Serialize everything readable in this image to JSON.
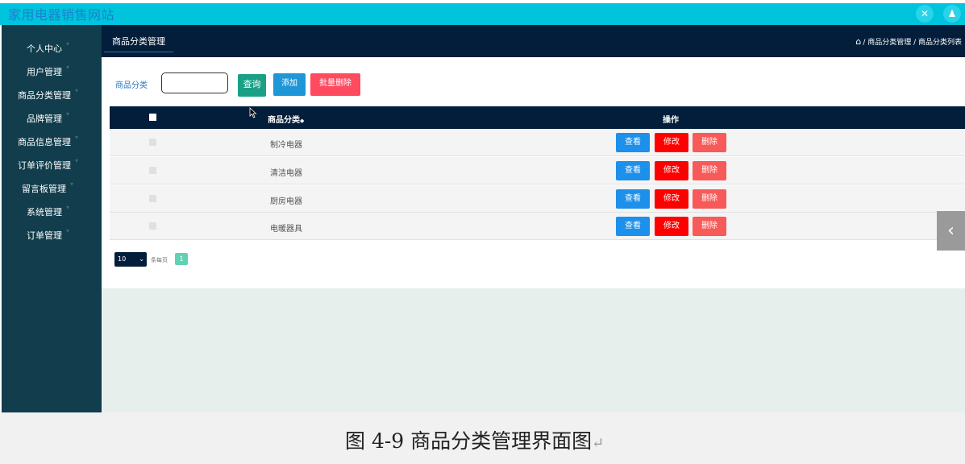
{
  "app": {
    "title": "家用电器销售网站"
  },
  "topbar": {
    "icon_close": "✕",
    "icon_user": "👤"
  },
  "sidebar": {
    "items": [
      {
        "label": "个人中心"
      },
      {
        "label": "用户管理"
      },
      {
        "label": "商品分类管理"
      },
      {
        "label": "品牌管理"
      },
      {
        "label": "商品信息管理"
      },
      {
        "label": "订单评价管理"
      },
      {
        "label": "留言板管理"
      },
      {
        "label": "系统管理"
      },
      {
        "label": "订单管理"
      }
    ]
  },
  "header": {
    "tab": "商品分类管理",
    "breadcrumb": "/ 商品分类管理 / 商品分类列表"
  },
  "search": {
    "label": "商品分类",
    "placeholder": "",
    "value": "",
    "query_label": "查询",
    "add_label": "添加",
    "batch_delete_label": "批量删除"
  },
  "table": {
    "columns": [
      "商品分类",
      "操作"
    ],
    "sort_glyph": "◆",
    "rows": [
      {
        "name": "制冷电器"
      },
      {
        "name": "清洁电器"
      },
      {
        "name": "厨房电器"
      },
      {
        "name": "电暖器具"
      }
    ],
    "actions": {
      "view": "查看",
      "edit": "修改",
      "delete": "删除"
    }
  },
  "pagination": {
    "page_size": "10",
    "per_page_text": "条每页",
    "current_page": "1"
  },
  "colors": {
    "topbar": "#00c3dc",
    "sidebar": "#113d4c",
    "header": "#021e3a",
    "view": "#1c90ea",
    "edit": "#ff0000",
    "delete": "#f75a58"
  },
  "caption": {
    "text": "图 4-9 商品分类管理界面图"
  }
}
